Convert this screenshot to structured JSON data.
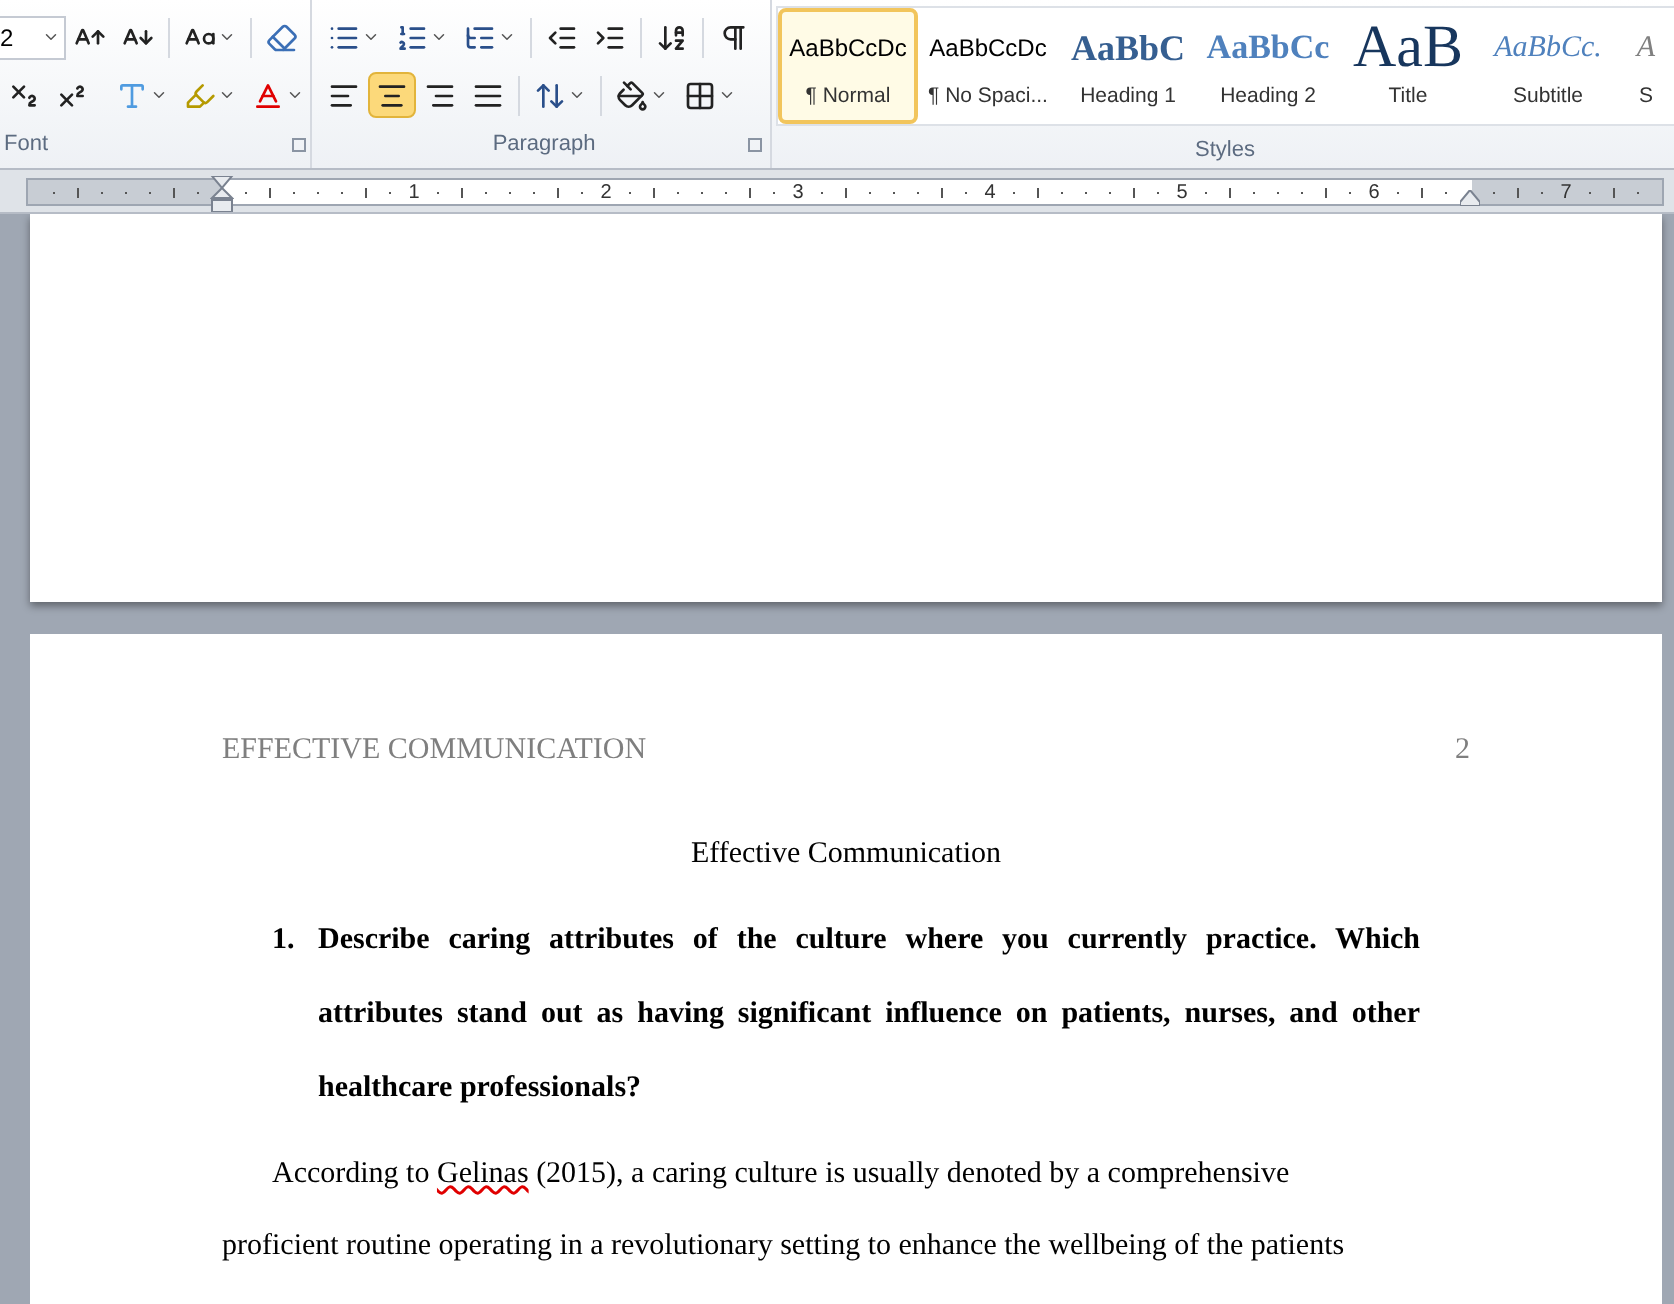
{
  "ribbon": {
    "font_group": {
      "label": "Font",
      "font_size": "2"
    },
    "paragraph_group": {
      "label": "Paragraph",
      "alignments": [
        {
          "kind": "left",
          "selected": false
        },
        {
          "kind": "center",
          "selected": true
        },
        {
          "kind": "right",
          "selected": false
        },
        {
          "kind": "justify",
          "selected": false
        }
      ]
    },
    "styles_group": {
      "label": "Styles",
      "styles": [
        {
          "kind": "normal",
          "preview": "AaBbCcDc",
          "name": "¶ Normal",
          "selected": true
        },
        {
          "kind": "no_spacing",
          "preview": "AaBbCcDc",
          "name": "¶ No Spaci...",
          "selected": false
        },
        {
          "kind": "heading1",
          "preview": "AaBbC",
          "name": "Heading 1",
          "selected": false
        },
        {
          "kind": "heading2",
          "preview": "AaBbCc",
          "name": "Heading 2",
          "selected": false
        },
        {
          "kind": "title",
          "preview": "AaB",
          "name": "Title",
          "selected": false
        },
        {
          "kind": "subtitle",
          "preview": "AaBbCc.",
          "name": "Subtitle",
          "selected": false
        },
        {
          "kind": "subtle",
          "preview": "A",
          "name": "S",
          "selected": false
        }
      ]
    }
  },
  "ruler": {
    "labels": [
      "1",
      "2",
      "3",
      "4",
      "5",
      "6",
      "7"
    ]
  },
  "page_2": {
    "header_left": "EFFECTIVE COMMUNICATION",
    "page_number": "2",
    "title": "Effective Communication",
    "list": [
      {
        "number": "1.",
        "text": "Describe caring attributes of the culture where you currently practice. Which attributes stand out as having significant influence on patients, nurses, and other healthcare professionals?"
      }
    ],
    "paragraph": {
      "before": "According to ",
      "flagged_word": "Gelinas",
      "after": " (2015), a caring culture is usually denoted by a comprehensive proficient routine operating in a revolutionary setting to enhance the wellbeing of the patients"
    }
  }
}
